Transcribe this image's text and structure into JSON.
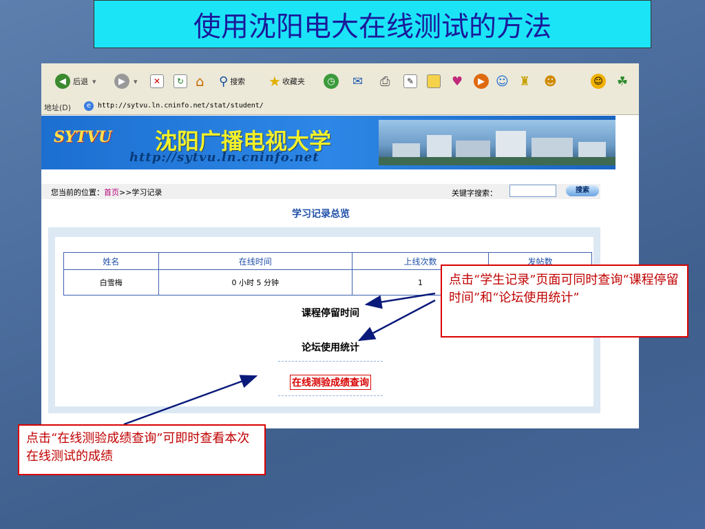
{
  "slide": {
    "title": "使用沈阳电大在线测试的方法"
  },
  "browser": {
    "toolbar": {
      "back_label": "后退",
      "search_label": "搜索",
      "favorites_label": "收藏夹"
    },
    "address": {
      "label": "地址(D)",
      "url": "http://sytvu.ln.cninfo.net/stat/student/"
    }
  },
  "page": {
    "banner": {
      "logo_text": "SYTVU",
      "university_name": "沈阳广播电视大学",
      "url_art": "http://sytvu.ln.cninfo.net"
    },
    "breadcrumb": {
      "prefix": "您当前的位置：",
      "home": "首页",
      "current": ">>学习记录"
    },
    "keyword_search": {
      "label": "关键字搜索：",
      "value": "",
      "button": "搜索"
    },
    "section_title": "学习记录总览",
    "table": {
      "headers": [
        "姓名",
        "在线时间",
        "上线次数",
        "发帖数"
      ],
      "rows": [
        [
          "白雪梅",
          "0 小时 5 分钟",
          "1",
          ""
        ]
      ]
    },
    "links": {
      "course_time": "课程停留时间",
      "forum_stats": "论坛使用统计",
      "test_results": "在线测验成绩查询"
    }
  },
  "callouts": {
    "right": "点击“学生记录”页面可同时查询“课程停留时间”和“论坛使用统计”",
    "left": "点击“在线测验成绩查询”可即时查看本次在线测试的成绩"
  },
  "colors": {
    "title_bg": "#1be4f7",
    "callout_border": "#d90000",
    "arrow": "#0a1a7a"
  }
}
